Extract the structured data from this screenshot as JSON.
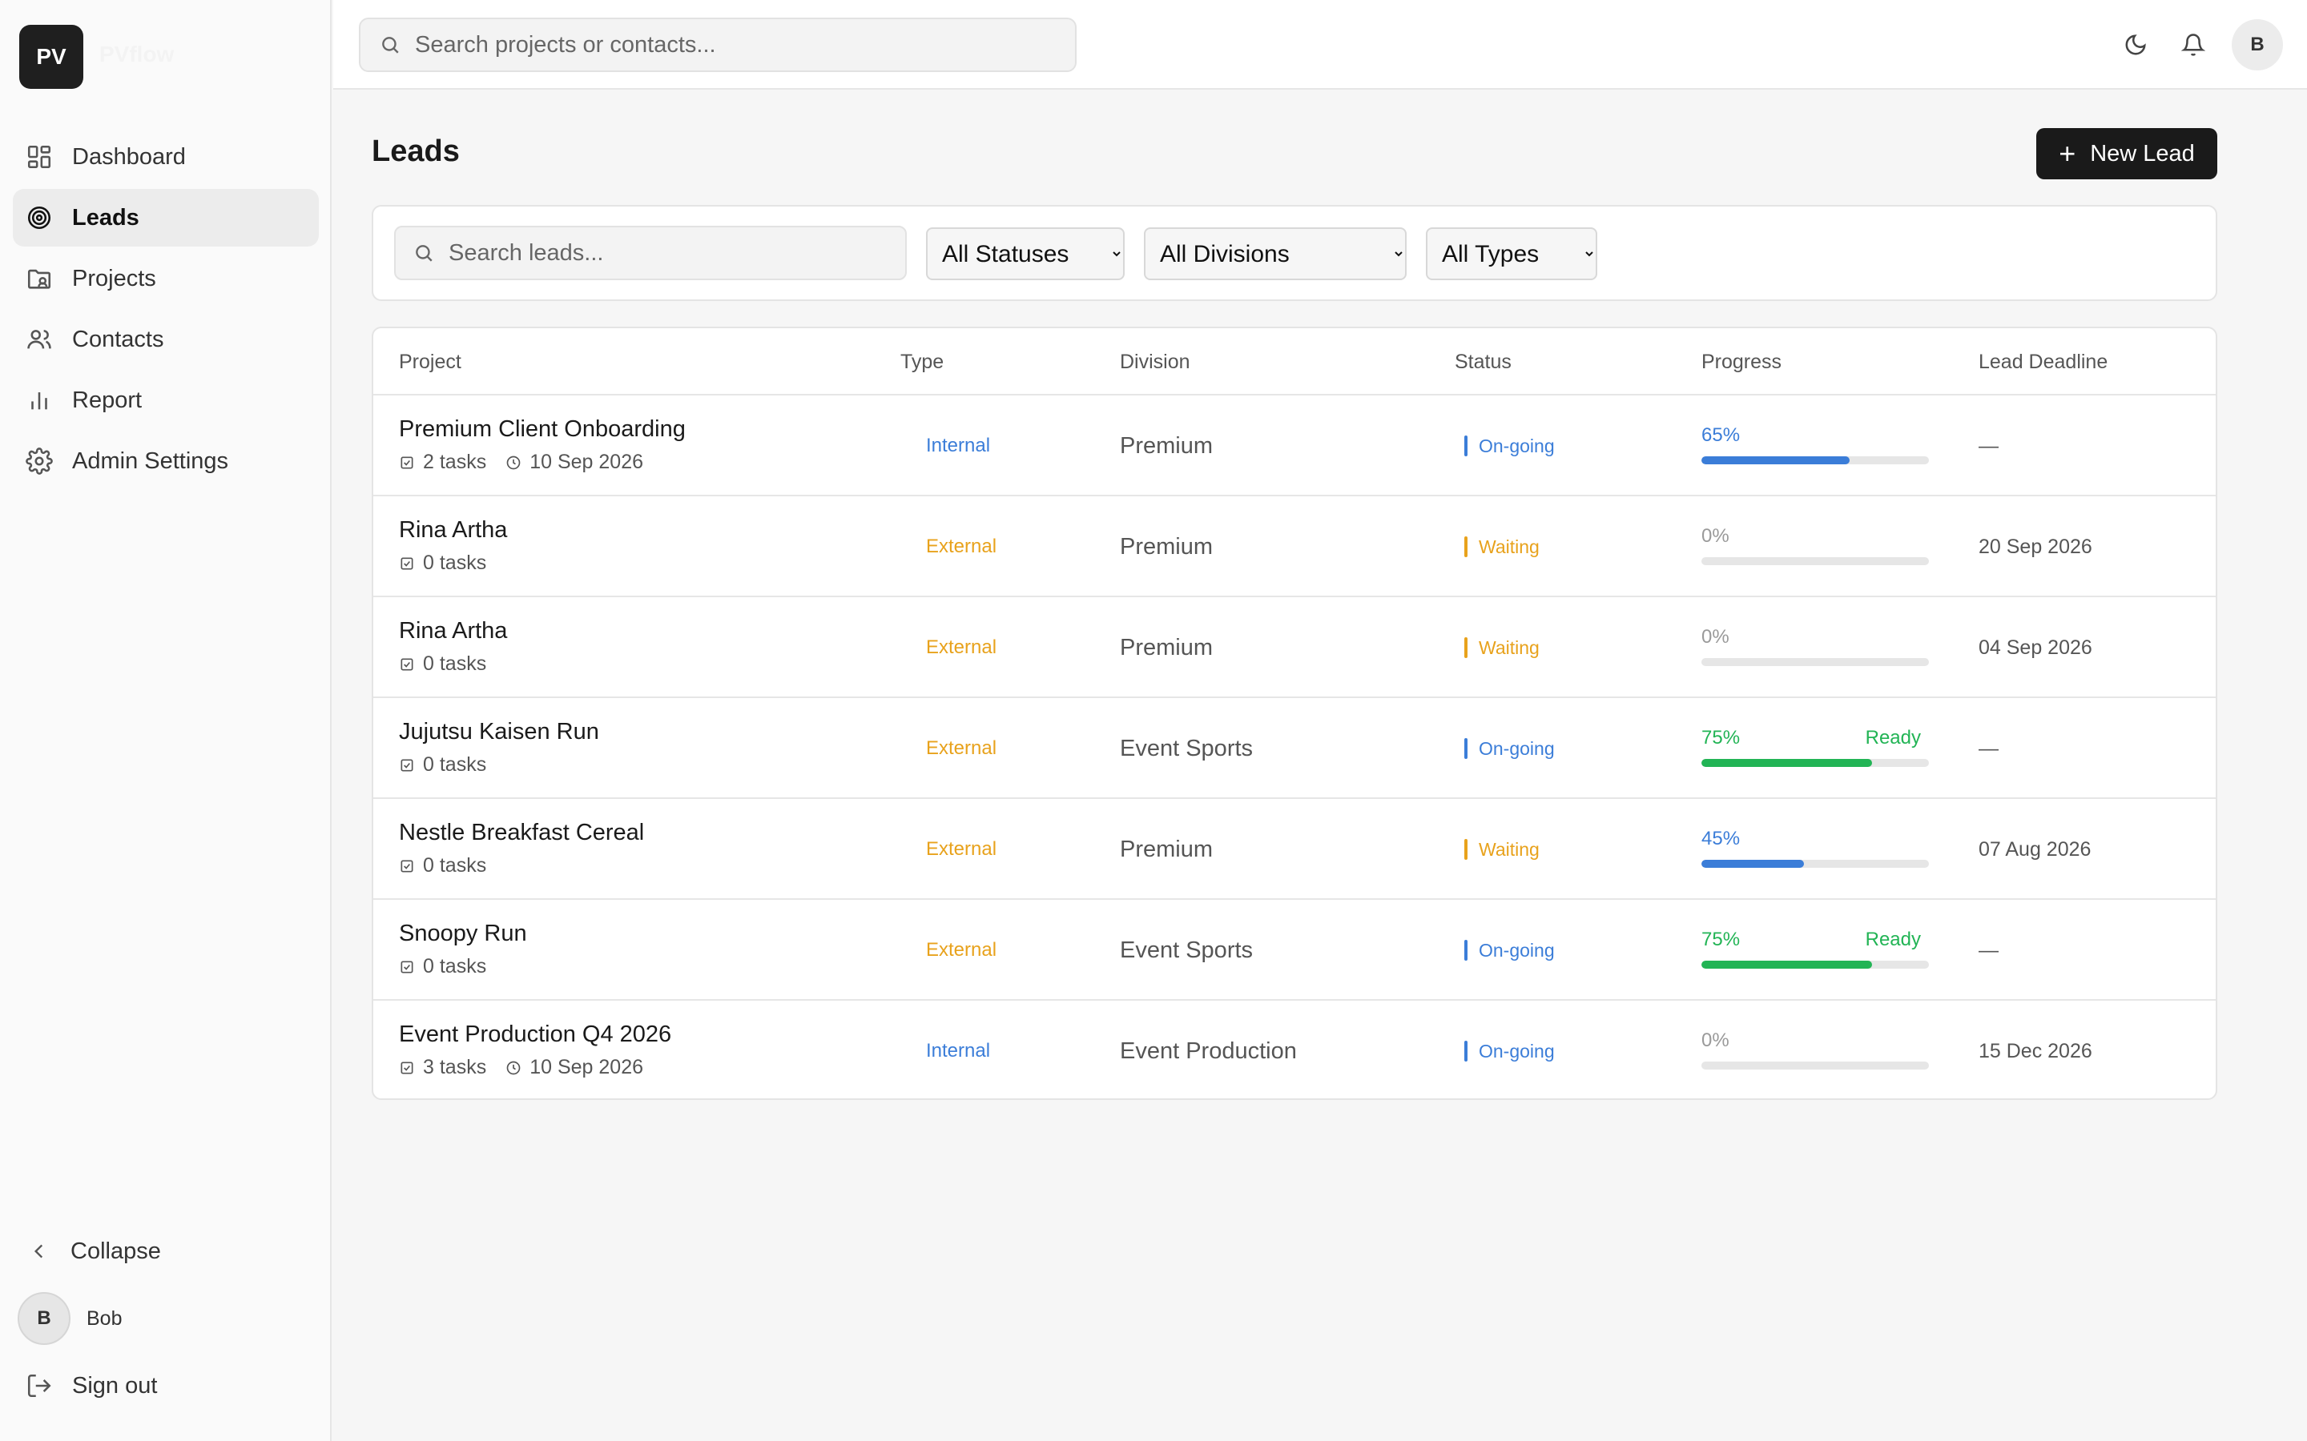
{
  "app": {
    "logo": "PV",
    "brand": "PVflow"
  },
  "sidebar": {
    "items": [
      {
        "label": "Dashboard",
        "icon": "dashboard-icon",
        "active": false
      },
      {
        "label": "Leads",
        "icon": "target-icon",
        "active": true
      },
      {
        "label": "Projects",
        "icon": "folder-icon",
        "active": false
      },
      {
        "label": "Contacts",
        "icon": "users-icon",
        "active": false
      },
      {
        "label": "Report",
        "icon": "bar-chart-icon",
        "active": false
      },
      {
        "label": "Admin Settings",
        "icon": "gear-icon",
        "active": false
      }
    ],
    "collapse_label": "Collapse",
    "user": {
      "initial": "B",
      "name": "Bob"
    },
    "signout_label": "Sign out"
  },
  "topbar": {
    "search_placeholder": "Search projects or contacts...",
    "avatar_initial": "B"
  },
  "main": {
    "title": "Leads",
    "new_lead_label": "New Lead",
    "search_placeholder": "Search leads...",
    "filters": {
      "status": "All Statuses",
      "division": "All Divisions",
      "type": "All Types"
    }
  },
  "table": {
    "columns": [
      "Project",
      "Type",
      "Division",
      "Status",
      "Progress",
      "Lead Deadline"
    ],
    "rows": [
      {
        "name": "Premium Client Onboarding",
        "tasks": "2 tasks",
        "date": "10 Sep 2026",
        "type": "Internal",
        "division": "Premium",
        "status": "On-going",
        "progress": 65,
        "progress_label": "65%",
        "ready": "",
        "deadline": "—"
      },
      {
        "name": "Rina Artha",
        "tasks": "0 tasks",
        "date": "",
        "type": "External",
        "division": "Premium",
        "status": "Waiting",
        "progress": 0,
        "progress_label": "0%",
        "ready": "",
        "deadline": "20 Sep 2026"
      },
      {
        "name": "Rina Artha",
        "tasks": "0 tasks",
        "date": "",
        "type": "External",
        "division": "Premium",
        "status": "Waiting",
        "progress": 0,
        "progress_label": "0%",
        "ready": "",
        "deadline": "04 Sep 2026"
      },
      {
        "name": "Jujutsu Kaisen Run",
        "tasks": "0 tasks",
        "date": "",
        "type": "External",
        "division": "Event Sports",
        "status": "On-going",
        "progress": 75,
        "progress_label": "75%",
        "ready": "Ready",
        "deadline": "—"
      },
      {
        "name": "Nestle Breakfast Cereal",
        "tasks": "0 tasks",
        "date": "",
        "type": "External",
        "division": "Premium",
        "status": "Waiting",
        "progress": 45,
        "progress_label": "45%",
        "ready": "",
        "deadline": "07 Aug 2026"
      },
      {
        "name": "Snoopy Run",
        "tasks": "0 tasks",
        "date": "",
        "type": "External",
        "division": "Event Sports",
        "status": "On-going",
        "progress": 75,
        "progress_label": "75%",
        "ready": "Ready",
        "deadline": "—"
      },
      {
        "name": "Event Production Q4 2026",
        "tasks": "3 tasks",
        "date": "10 Sep 2026",
        "type": "Internal",
        "division": "Event Production",
        "status": "On-going",
        "progress": 0,
        "progress_label": "0%",
        "ready": "",
        "deadline": "15 Dec 2026"
      }
    ]
  },
  "colors": {
    "internal": "#3b7dd8",
    "external": "#e8a21c",
    "ongoing": "#3b7dd8",
    "waiting": "#e8a21c",
    "progress_blue": "#3b7dd8",
    "progress_green": "#22b455",
    "progress_zero": "#9a9a9a"
  }
}
